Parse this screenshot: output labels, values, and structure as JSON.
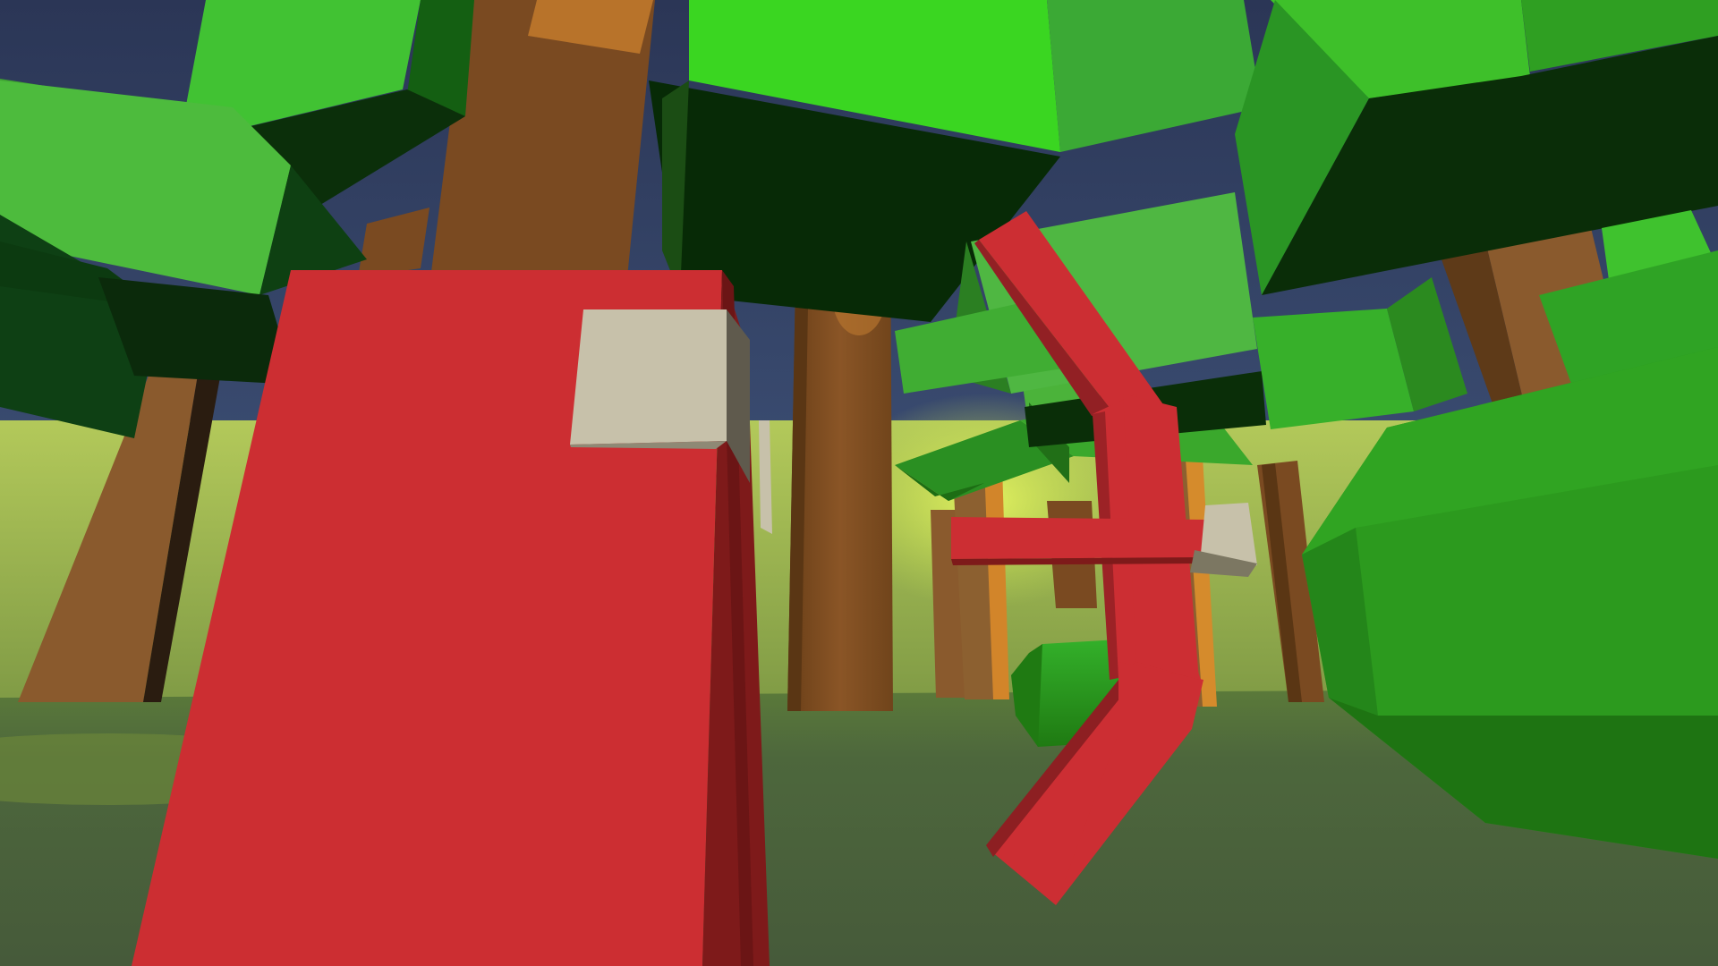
{
  "scene": {
    "view": "first-person",
    "environment": "low-poly forest",
    "held_item": "bow",
    "colors": {
      "sky": "#2f3d5e",
      "horizon_glow": "#c9e85a",
      "far_ground": "#8aa64c",
      "ground": "#4b613c",
      "trunk": "#7a4a21",
      "trunk_light": "#8a5a2d",
      "trunk_shadow": "#5a3614",
      "leaf_light": "#3bd822",
      "leaf_mid": "#35a92a",
      "leaf_dark": "#0a2d08",
      "bush": "#2c9a1e",
      "bush_dark": "#1d7410",
      "player_red": "#cc2e32",
      "player_red_dark": "#7e1a1a",
      "player_accent": "#c7c1aa",
      "bow_red": "#cc2e33"
    }
  }
}
